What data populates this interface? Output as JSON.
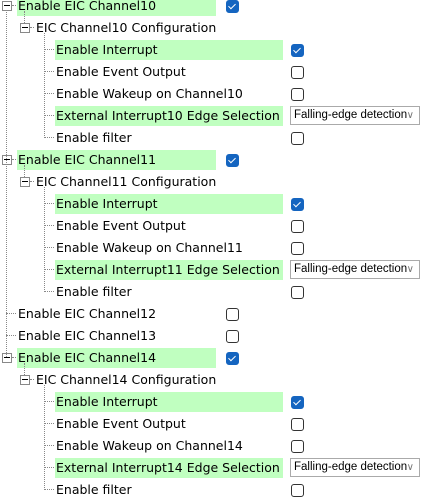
{
  "rows": [
    {
      "level": 0,
      "label": "Enable EIC Channel10",
      "hl": true,
      "control": "checkbox",
      "checked": true
    },
    {
      "level": 1,
      "label": "EIC Channel10 Configuration",
      "hl": false,
      "control": "none"
    },
    {
      "level": 2,
      "label": "Enable Interrupt",
      "hl": true,
      "control": "checkbox",
      "checked": true
    },
    {
      "level": 2,
      "label": "Enable Event Output",
      "hl": false,
      "control": "checkbox",
      "checked": false
    },
    {
      "level": 2,
      "label": "Enable Wakeup on Channel10",
      "hl": false,
      "control": "checkbox",
      "checked": false
    },
    {
      "level": 2,
      "label": "External Interrupt10 Edge Selection",
      "hl": true,
      "control": "dropdown",
      "value": "Falling-edge detection"
    },
    {
      "level": 2,
      "label": "Enable filter",
      "hl": false,
      "control": "checkbox",
      "checked": false
    },
    {
      "level": 0,
      "label": "Enable EIC Channel11",
      "hl": true,
      "control": "checkbox",
      "checked": true
    },
    {
      "level": 1,
      "label": "EIC Channel11 Configuration",
      "hl": false,
      "control": "none"
    },
    {
      "level": 2,
      "label": "Enable Interrupt",
      "hl": true,
      "control": "checkbox",
      "checked": true
    },
    {
      "level": 2,
      "label": "Enable Event Output",
      "hl": false,
      "control": "checkbox",
      "checked": false
    },
    {
      "level": 2,
      "label": "Enable Wakeup on Channel11",
      "hl": false,
      "control": "checkbox",
      "checked": false
    },
    {
      "level": 2,
      "label": "External Interrupt11 Edge Selection",
      "hl": true,
      "control": "dropdown",
      "value": "Falling-edge detection"
    },
    {
      "level": 2,
      "label": "Enable filter",
      "hl": false,
      "control": "checkbox",
      "checked": false
    },
    {
      "level": 0,
      "label": "Enable EIC Channel12",
      "hl": false,
      "control": "checkbox",
      "checked": false,
      "leaf": true
    },
    {
      "level": 0,
      "label": "Enable EIC Channel13",
      "hl": false,
      "control": "checkbox",
      "checked": false,
      "leaf": true
    },
    {
      "level": 0,
      "label": "Enable EIC Channel14",
      "hl": true,
      "control": "checkbox",
      "checked": true
    },
    {
      "level": 1,
      "label": "EIC Channel14 Configuration",
      "hl": false,
      "control": "none"
    },
    {
      "level": 2,
      "label": "Enable Interrupt",
      "hl": true,
      "control": "checkbox",
      "checked": true
    },
    {
      "level": 2,
      "label": "Enable Event Output",
      "hl": false,
      "control": "checkbox",
      "checked": false
    },
    {
      "level": 2,
      "label": "Enable Wakeup on Channel14",
      "hl": false,
      "control": "checkbox",
      "checked": false
    },
    {
      "level": 2,
      "label": "External Interrupt14 Edge Selection",
      "hl": true,
      "control": "dropdown",
      "value": "Falling-edge detection"
    },
    {
      "level": 2,
      "label": "Enable filter",
      "hl": false,
      "control": "checkbox",
      "checked": false
    }
  ],
  "colors": {
    "highlight": "#c0ffc0",
    "checked": "#1565c0"
  }
}
